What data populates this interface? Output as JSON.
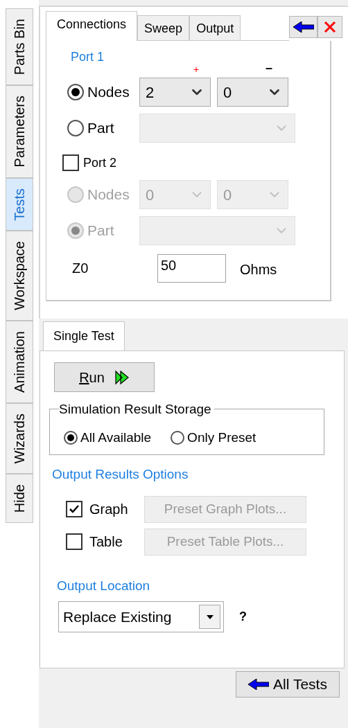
{
  "side_tabs": [
    {
      "label": "Parts Bin",
      "selected": false
    },
    {
      "label": "Parameters",
      "selected": false
    },
    {
      "label": "Tests",
      "selected": true
    },
    {
      "label": "Workspace",
      "selected": false
    },
    {
      "label": "Animation",
      "selected": false
    },
    {
      "label": "Wizards",
      "selected": false
    },
    {
      "label": "Hide",
      "selected": false
    }
  ],
  "top_tabs": [
    {
      "label": "Connections",
      "selected": true
    },
    {
      "label": "Sweep",
      "selected": false
    },
    {
      "label": "Output",
      "selected": false
    }
  ],
  "port1": {
    "title": "Port 1",
    "plus_label": "+",
    "minus_label": "–",
    "options": [
      {
        "kind": "nodes",
        "label": "Nodes",
        "selected": true,
        "disabled": false,
        "dropdowns": [
          {
            "value": "2",
            "disabled": false
          },
          {
            "value": "0",
            "disabled": false
          }
        ]
      },
      {
        "kind": "part",
        "label": "Part",
        "selected": false,
        "disabled": false,
        "dropdowns": [
          {
            "disabled": true
          }
        ]
      }
    ]
  },
  "port2": {
    "label": "Port 2",
    "checked": false,
    "options": [
      {
        "kind": "nodes",
        "label": "Nodes",
        "selected": false,
        "disabled": true,
        "dropdowns": [
          {
            "value": "0",
            "disabled": true
          },
          {
            "value": "0",
            "disabled": true
          }
        ]
      },
      {
        "kind": "part",
        "label": "Part",
        "selected": true,
        "disabled": true,
        "dropdowns": [
          {
            "disabled": true
          }
        ]
      }
    ]
  },
  "z0": {
    "label": "Z0",
    "value": "50",
    "unit": "Ohms"
  },
  "bottom_tab": {
    "label": "Single Test",
    "selected": true
  },
  "run_button": {
    "label": "Run"
  },
  "storage": {
    "title": "Simulation Result Storage",
    "options": [
      {
        "label": "All Available",
        "selected": true
      },
      {
        "label": "Only Preset",
        "selected": false
      }
    ]
  },
  "output_results": {
    "title": "Output Results Options",
    "items": [
      {
        "label": "Graph",
        "checked": true,
        "button": "Preset Graph Plots...",
        "button_disabled": true
      },
      {
        "label": "Table",
        "checked": false,
        "button": "Preset Table Plots...",
        "button_disabled": true
      }
    ]
  },
  "output_location": {
    "title": "Output Location",
    "value": "Replace Existing",
    "help": "?"
  },
  "all_tests_button": {
    "label": "All Tests"
  }
}
